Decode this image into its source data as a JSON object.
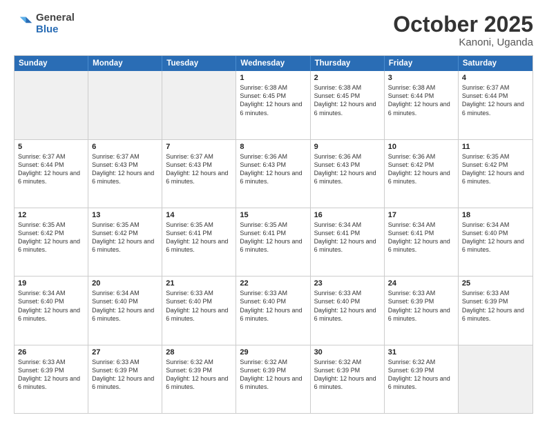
{
  "header": {
    "logo_general": "General",
    "logo_blue": "Blue",
    "month": "October 2025",
    "location": "Kanoni, Uganda"
  },
  "days_of_week": [
    "Sunday",
    "Monday",
    "Tuesday",
    "Wednesday",
    "Thursday",
    "Friday",
    "Saturday"
  ],
  "weeks": [
    [
      {
        "day": "",
        "info": "",
        "shaded": true
      },
      {
        "day": "",
        "info": "",
        "shaded": true
      },
      {
        "day": "",
        "info": "",
        "shaded": true
      },
      {
        "day": "1",
        "info": "Sunrise: 6:38 AM\nSunset: 6:45 PM\nDaylight: 12 hours and 6 minutes.",
        "shaded": false
      },
      {
        "day": "2",
        "info": "Sunrise: 6:38 AM\nSunset: 6:45 PM\nDaylight: 12 hours and 6 minutes.",
        "shaded": false
      },
      {
        "day": "3",
        "info": "Sunrise: 6:38 AM\nSunset: 6:44 PM\nDaylight: 12 hours and 6 minutes.",
        "shaded": false
      },
      {
        "day": "4",
        "info": "Sunrise: 6:37 AM\nSunset: 6:44 PM\nDaylight: 12 hours and 6 minutes.",
        "shaded": false
      }
    ],
    [
      {
        "day": "5",
        "info": "Sunrise: 6:37 AM\nSunset: 6:44 PM\nDaylight: 12 hours and 6 minutes.",
        "shaded": false
      },
      {
        "day": "6",
        "info": "Sunrise: 6:37 AM\nSunset: 6:43 PM\nDaylight: 12 hours and 6 minutes.",
        "shaded": false
      },
      {
        "day": "7",
        "info": "Sunrise: 6:37 AM\nSunset: 6:43 PM\nDaylight: 12 hours and 6 minutes.",
        "shaded": false
      },
      {
        "day": "8",
        "info": "Sunrise: 6:36 AM\nSunset: 6:43 PM\nDaylight: 12 hours and 6 minutes.",
        "shaded": false
      },
      {
        "day": "9",
        "info": "Sunrise: 6:36 AM\nSunset: 6:43 PM\nDaylight: 12 hours and 6 minutes.",
        "shaded": false
      },
      {
        "day": "10",
        "info": "Sunrise: 6:36 AM\nSunset: 6:42 PM\nDaylight: 12 hours and 6 minutes.",
        "shaded": false
      },
      {
        "day": "11",
        "info": "Sunrise: 6:35 AM\nSunset: 6:42 PM\nDaylight: 12 hours and 6 minutes.",
        "shaded": false
      }
    ],
    [
      {
        "day": "12",
        "info": "Sunrise: 6:35 AM\nSunset: 6:42 PM\nDaylight: 12 hours and 6 minutes.",
        "shaded": false
      },
      {
        "day": "13",
        "info": "Sunrise: 6:35 AM\nSunset: 6:42 PM\nDaylight: 12 hours and 6 minutes.",
        "shaded": false
      },
      {
        "day": "14",
        "info": "Sunrise: 6:35 AM\nSunset: 6:41 PM\nDaylight: 12 hours and 6 minutes.",
        "shaded": false
      },
      {
        "day": "15",
        "info": "Sunrise: 6:35 AM\nSunset: 6:41 PM\nDaylight: 12 hours and 6 minutes.",
        "shaded": false
      },
      {
        "day": "16",
        "info": "Sunrise: 6:34 AM\nSunset: 6:41 PM\nDaylight: 12 hours and 6 minutes.",
        "shaded": false
      },
      {
        "day": "17",
        "info": "Sunrise: 6:34 AM\nSunset: 6:41 PM\nDaylight: 12 hours and 6 minutes.",
        "shaded": false
      },
      {
        "day": "18",
        "info": "Sunrise: 6:34 AM\nSunset: 6:40 PM\nDaylight: 12 hours and 6 minutes.",
        "shaded": false
      }
    ],
    [
      {
        "day": "19",
        "info": "Sunrise: 6:34 AM\nSunset: 6:40 PM\nDaylight: 12 hours and 6 minutes.",
        "shaded": false
      },
      {
        "day": "20",
        "info": "Sunrise: 6:34 AM\nSunset: 6:40 PM\nDaylight: 12 hours and 6 minutes.",
        "shaded": false
      },
      {
        "day": "21",
        "info": "Sunrise: 6:33 AM\nSunset: 6:40 PM\nDaylight: 12 hours and 6 minutes.",
        "shaded": false
      },
      {
        "day": "22",
        "info": "Sunrise: 6:33 AM\nSunset: 6:40 PM\nDaylight: 12 hours and 6 minutes.",
        "shaded": false
      },
      {
        "day": "23",
        "info": "Sunrise: 6:33 AM\nSunset: 6:40 PM\nDaylight: 12 hours and 6 minutes.",
        "shaded": false
      },
      {
        "day": "24",
        "info": "Sunrise: 6:33 AM\nSunset: 6:39 PM\nDaylight: 12 hours and 6 minutes.",
        "shaded": false
      },
      {
        "day": "25",
        "info": "Sunrise: 6:33 AM\nSunset: 6:39 PM\nDaylight: 12 hours and 6 minutes.",
        "shaded": false
      }
    ],
    [
      {
        "day": "26",
        "info": "Sunrise: 6:33 AM\nSunset: 6:39 PM\nDaylight: 12 hours and 6 minutes.",
        "shaded": false
      },
      {
        "day": "27",
        "info": "Sunrise: 6:33 AM\nSunset: 6:39 PM\nDaylight: 12 hours and 6 minutes.",
        "shaded": false
      },
      {
        "day": "28",
        "info": "Sunrise: 6:32 AM\nSunset: 6:39 PM\nDaylight: 12 hours and 6 minutes.",
        "shaded": false
      },
      {
        "day": "29",
        "info": "Sunrise: 6:32 AM\nSunset: 6:39 PM\nDaylight: 12 hours and 6 minutes.",
        "shaded": false
      },
      {
        "day": "30",
        "info": "Sunrise: 6:32 AM\nSunset: 6:39 PM\nDaylight: 12 hours and 6 minutes.",
        "shaded": false
      },
      {
        "day": "31",
        "info": "Sunrise: 6:32 AM\nSunset: 6:39 PM\nDaylight: 12 hours and 6 minutes.",
        "shaded": false
      },
      {
        "day": "",
        "info": "",
        "shaded": true
      }
    ]
  ]
}
